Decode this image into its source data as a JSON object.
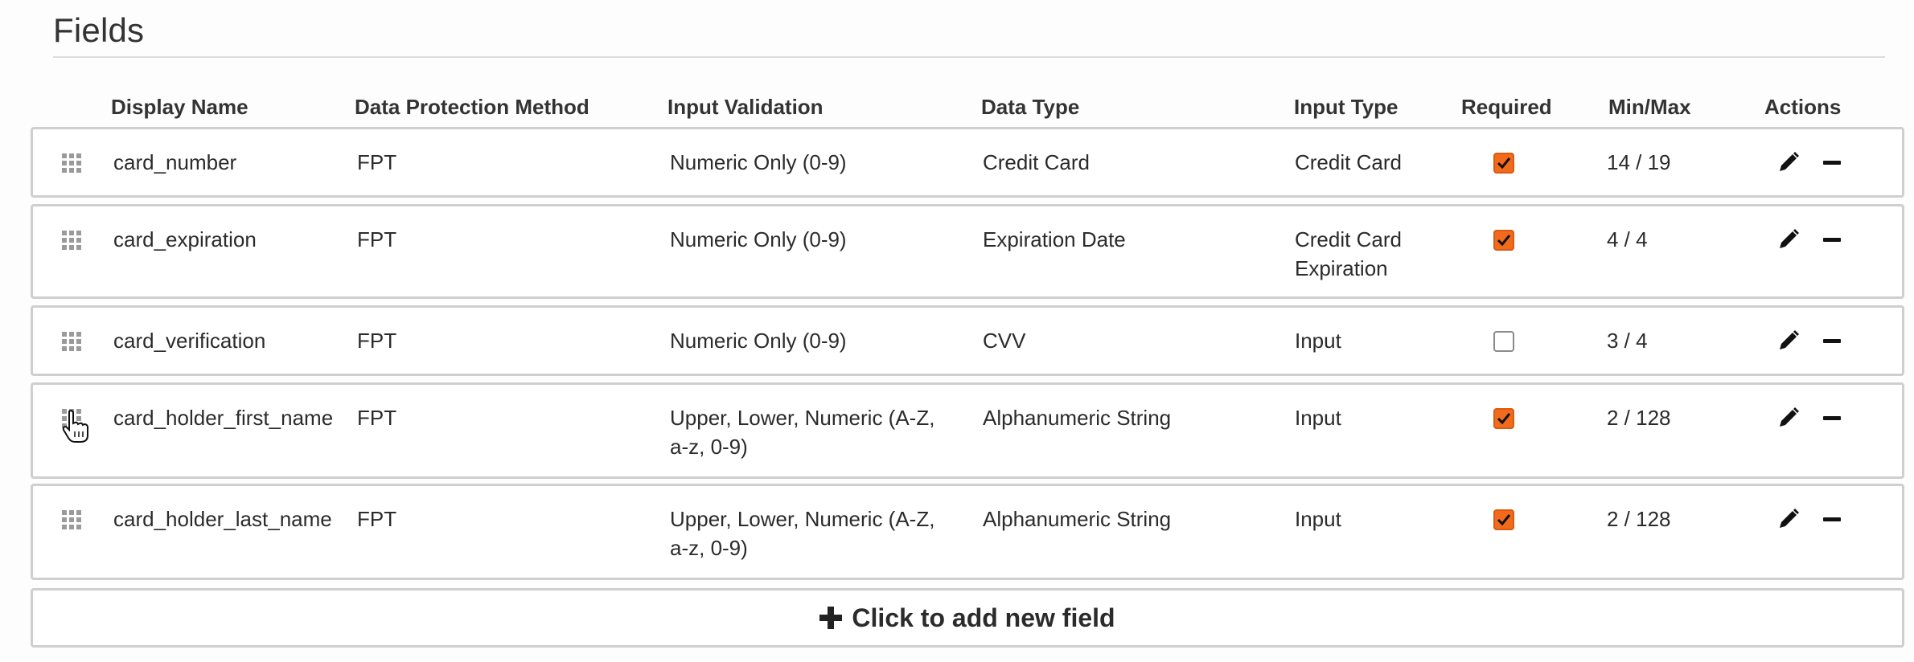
{
  "page": {
    "title": "Fields"
  },
  "columns": {
    "display_name": "Display Name",
    "protection": "Data Protection Method",
    "validation": "Input Validation",
    "data_type": "Data Type",
    "input_type": "Input Type",
    "required": "Required",
    "minmax": "Min/Max",
    "actions": "Actions"
  },
  "rows": [
    {
      "name": "card_number",
      "protection": "FPT",
      "validation_1": "Numeric Only (0-9)",
      "validation_2": "",
      "data_type": "Credit Card",
      "input_type_1": "Credit Card",
      "input_type_2": "",
      "required": true,
      "minmax": "14 / 19"
    },
    {
      "name": "card_expiration",
      "protection": "FPT",
      "validation_1": "Numeric Only (0-9)",
      "validation_2": "",
      "data_type": "Expiration Date",
      "input_type_1": "Credit Card",
      "input_type_2": "Expiration",
      "required": true,
      "minmax": "4 / 4"
    },
    {
      "name": "card_verification",
      "protection": "FPT",
      "validation_1": "Numeric Only (0-9)",
      "validation_2": "",
      "data_type": "CVV",
      "input_type_1": "Input",
      "input_type_2": "",
      "required": false,
      "minmax": "3 / 4"
    },
    {
      "name": "card_holder_first_name",
      "protection": "FPT",
      "validation_1": "Upper, Lower, Numeric (A-Z,",
      "validation_2": "a-z, 0-9)",
      "data_type": "Alphanumeric String",
      "input_type_1": "Input",
      "input_type_2": "",
      "required": true,
      "minmax": "2 / 128"
    },
    {
      "name": "card_holder_last_name",
      "protection": "FPT",
      "validation_1": "Upper, Lower, Numeric (A-Z,",
      "validation_2": "a-z, 0-9)",
      "data_type": "Alphanumeric String",
      "input_type_1": "Input",
      "input_type_2": "",
      "required": true,
      "minmax": "2 / 128"
    }
  ],
  "add_field": {
    "label": "Click to add new field",
    "icon": "plus-icon"
  },
  "icons": {
    "drag": "drag-handle-icon",
    "edit": "pencil-icon",
    "remove": "minus-icon"
  },
  "colors": {
    "checkbox_checked": "#f26b1d",
    "row_border": "#cfcfcf"
  }
}
